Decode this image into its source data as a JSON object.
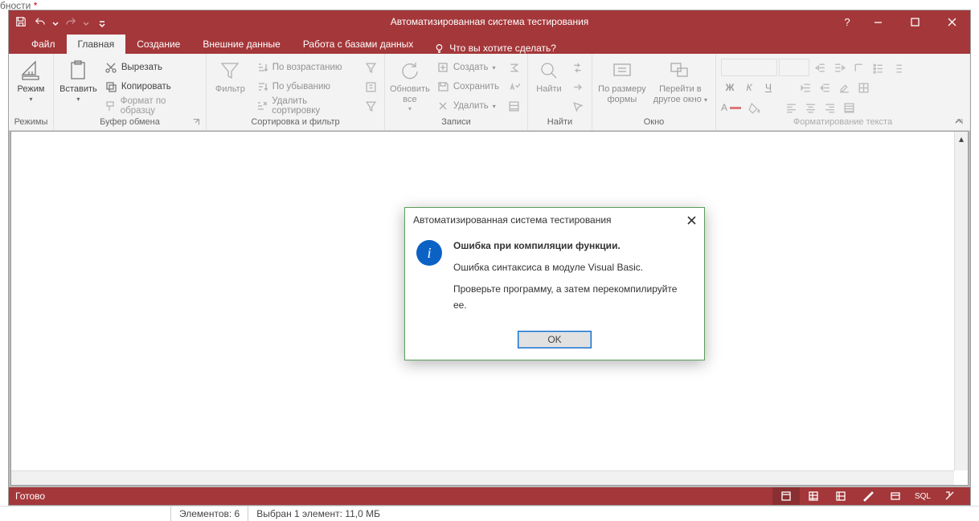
{
  "fragment_text": "бности",
  "titlebar": {
    "title": "Автоматизированная система тестирования"
  },
  "tabs": {
    "file": "Файл",
    "home": "Главная",
    "create": "Создание",
    "external": "Внешние данные",
    "dbtools": "Работа с базами данных",
    "tellme": "Что вы хотите сделать?"
  },
  "ribbon": {
    "groups": {
      "views": {
        "label": "Режимы",
        "view_btn": "Режим"
      },
      "clipboard": {
        "label": "Буфер обмена",
        "paste": "Вставить",
        "cut": "Вырезать",
        "copy": "Копировать",
        "format_painter": "Формат по образцу"
      },
      "sortfilter": {
        "label": "Сортировка и фильтр",
        "filter": "Фильтр",
        "asc": "По возрастанию",
        "desc": "По убыванию",
        "remove": "Удалить сортировку"
      },
      "records": {
        "label": "Записи",
        "refresh": "Обновить все",
        "create": "Создать",
        "save": "Сохранить",
        "delete": "Удалить"
      },
      "find": {
        "label": "Найти",
        "find_btn": "Найти"
      },
      "window": {
        "label": "Окно",
        "fit": "По размеру формы",
        "switch": "Перейти в другое окно"
      },
      "textfmt": {
        "label": "Форматирование текста"
      }
    }
  },
  "dialog": {
    "title": "Автоматизированная система тестирования",
    "heading": "Ошибка при компиляции функции.",
    "line1": "Ошибка синтаксиса в модуле Visual Basic.",
    "line2": "Проверьте программу, а затем перекомпилируйте ее.",
    "ok": "OK"
  },
  "status": {
    "ready": "Готово",
    "sql": "SQL"
  },
  "osbar": {
    "elements": "Элементов: 6",
    "selected": "Выбран 1 элемент: 11,0 МБ"
  }
}
